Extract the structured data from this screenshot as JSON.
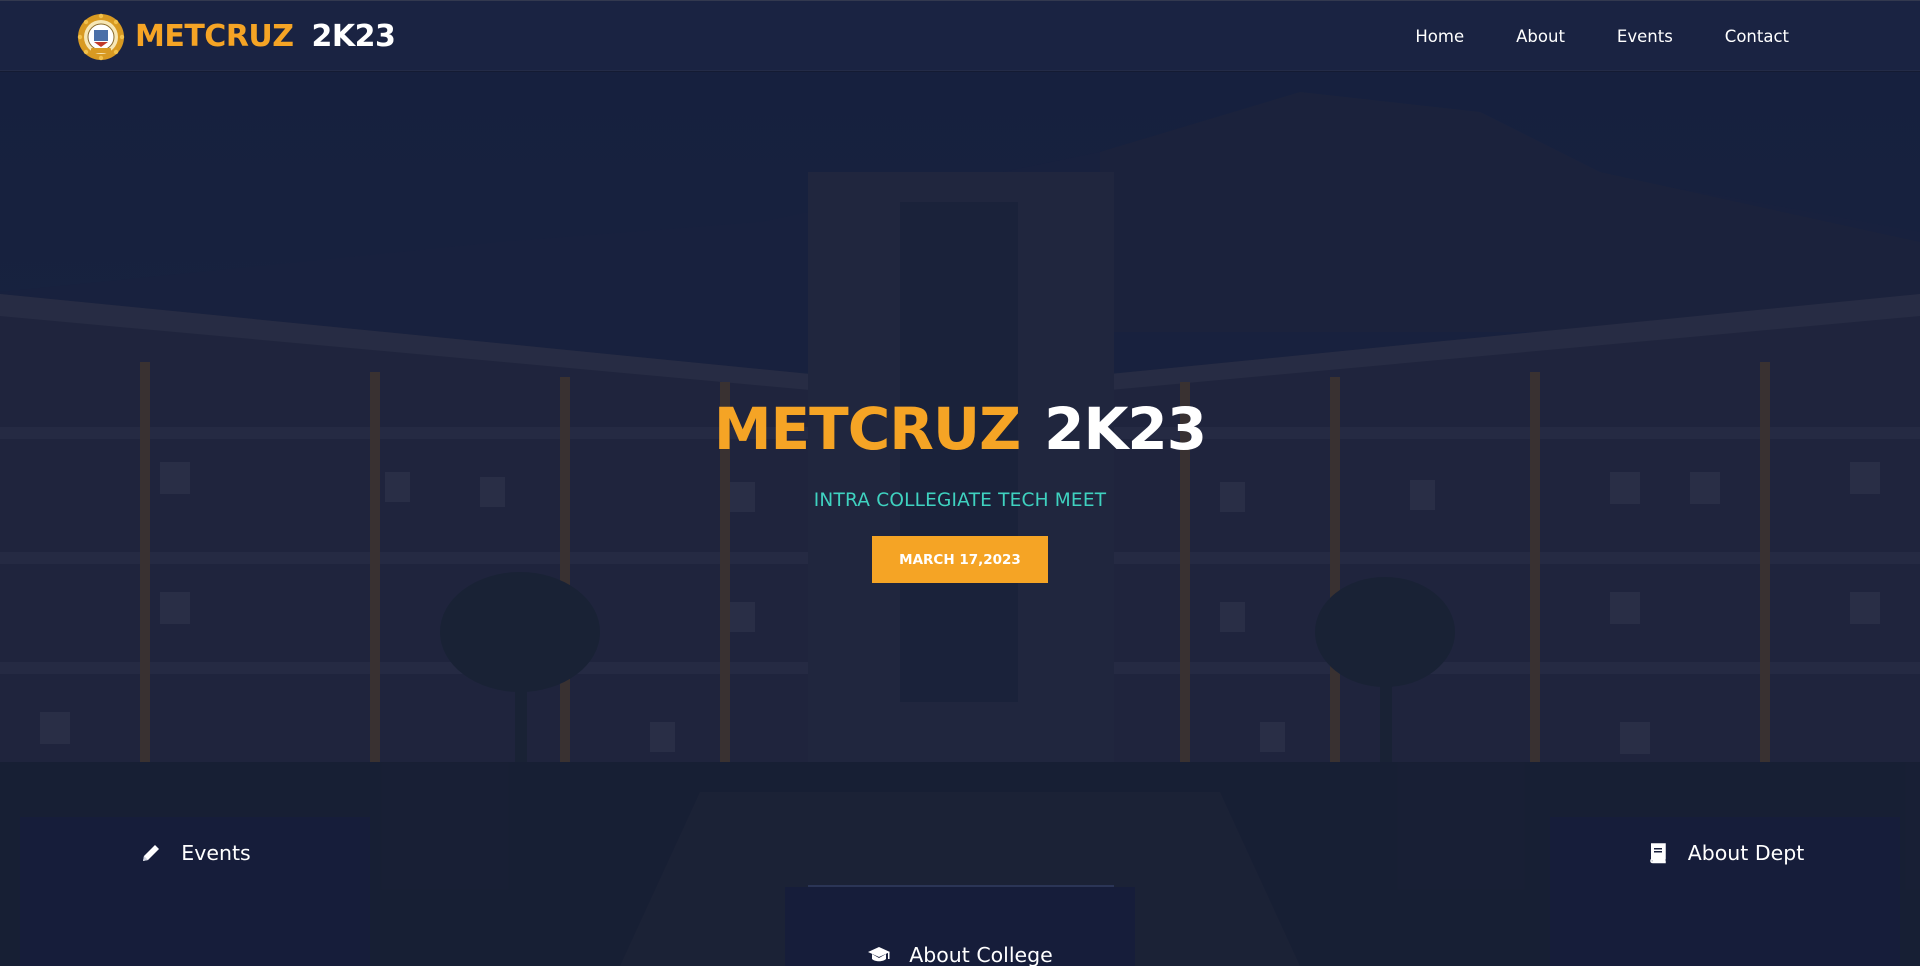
{
  "header": {
    "brand_primary": "METCRUZ",
    "brand_secondary": "2K23",
    "logo_icon": "college-emblem-icon"
  },
  "nav": {
    "items": [
      {
        "label": "Home"
      },
      {
        "label": "About"
      },
      {
        "label": "Events"
      },
      {
        "label": "Contact"
      }
    ]
  },
  "hero": {
    "title_primary": "METCRUZ",
    "title_secondary": "2K23",
    "subtitle": "INTRA COLLEGIATE TECH MEET",
    "date_button": "MARCH 17,2023"
  },
  "features": [
    {
      "label": "Events",
      "icon": "pencil-icon"
    },
    {
      "label": "About College",
      "icon": "graduation-cap-icon"
    },
    {
      "label": "About Dept",
      "icon": "book-icon"
    }
  ],
  "colors": {
    "accent": "#f5a425",
    "subtitle": "#3fd2c0",
    "navbar": "#1a2342",
    "card": "#161d3a"
  }
}
